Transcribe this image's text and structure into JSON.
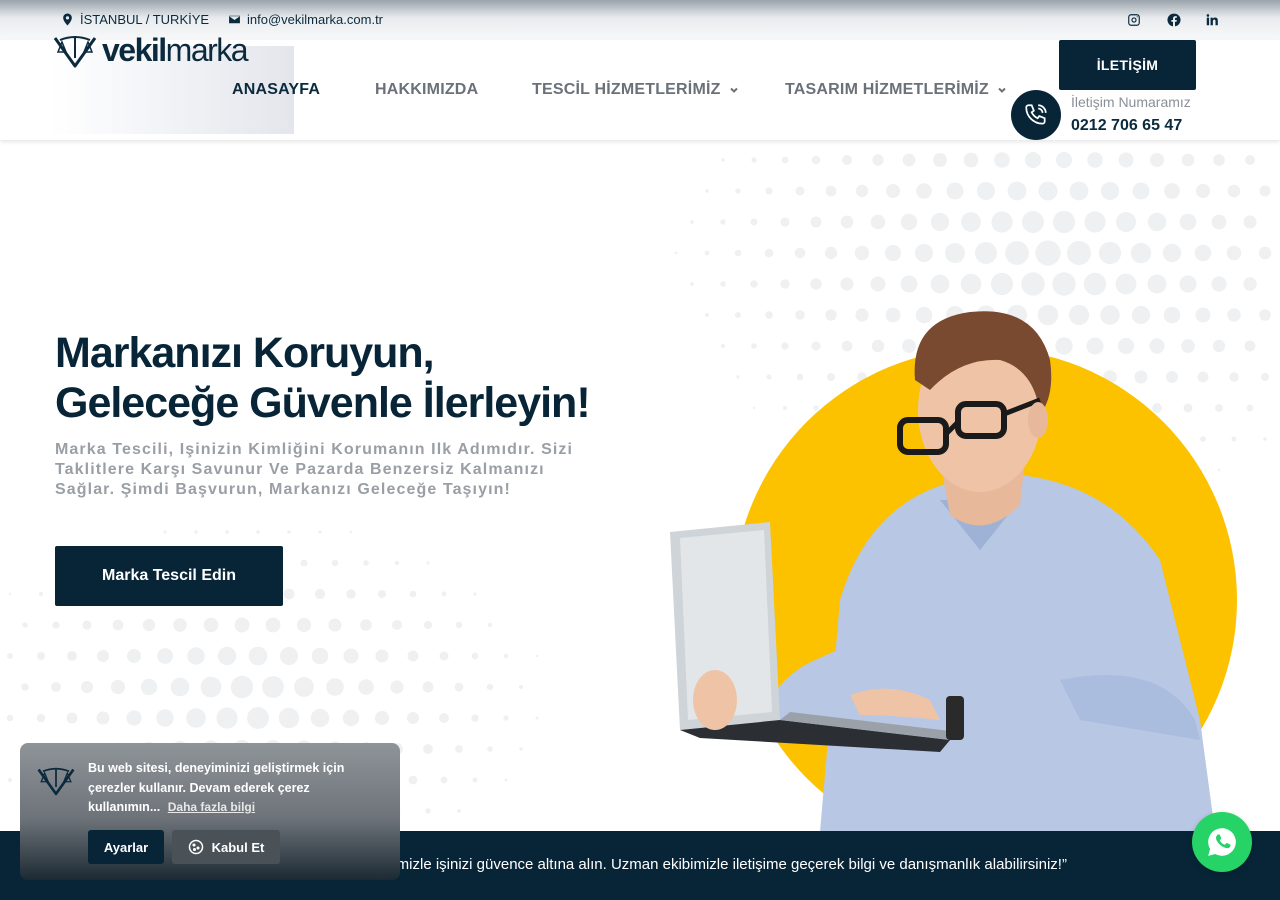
{
  "topbar": {
    "location": "İSTANBUL / TURKİYE",
    "email": "info@vekilmarka.com.tr",
    "social": [
      "instagram-icon",
      "facebook-icon",
      "linkedin-icon"
    ]
  },
  "header": {
    "logo_bold": "vekil",
    "logo_thin": "marka",
    "nav": {
      "home": "ANASAYFA",
      "about": "HAKKIMIZDA",
      "registration": "TESCİL HİZMETLERİMİZ",
      "design": "TASARIM HİZMETLERİMİZ"
    },
    "contact_button": "İLETİŞİM",
    "phone_label": "İletişim Numaramız",
    "phone_number": "0212 706 65 47"
  },
  "hero": {
    "title_line1": "Markanızı Koruyun,",
    "title_line2": "Geleceğe Güvenle İlerleyin!",
    "subtitle": "Marka Tescili, Işinizin Kimliğini Korumanın Ilk Adımıdır. Sizi Taklitlere Karşı Savunur Ve Pazarda Benzersiz Kalmanızı Sağlar. Şimdi Başvurun, Markanızı Geleceğe Taşıyın!",
    "cta": "Marka Tescil Edin"
  },
  "band": {
    "text": "erimizle işinizi güvence altına alın. Uzman ekibimizle iletişime geçerek bilgi ve danışmanlık alabilirsiniz!”"
  },
  "cookie": {
    "text": "Bu web sitesi, deneyiminizi geliştirmek için çerezler kullanır. Devam ederek çerez kullanımın...",
    "more": "Daha fazla bilgi",
    "settings": "Ayarlar",
    "accept": "Kabul Et"
  },
  "colors": {
    "primary": "#082538",
    "accent": "#fcc200",
    "whatsapp": "#25d366"
  }
}
